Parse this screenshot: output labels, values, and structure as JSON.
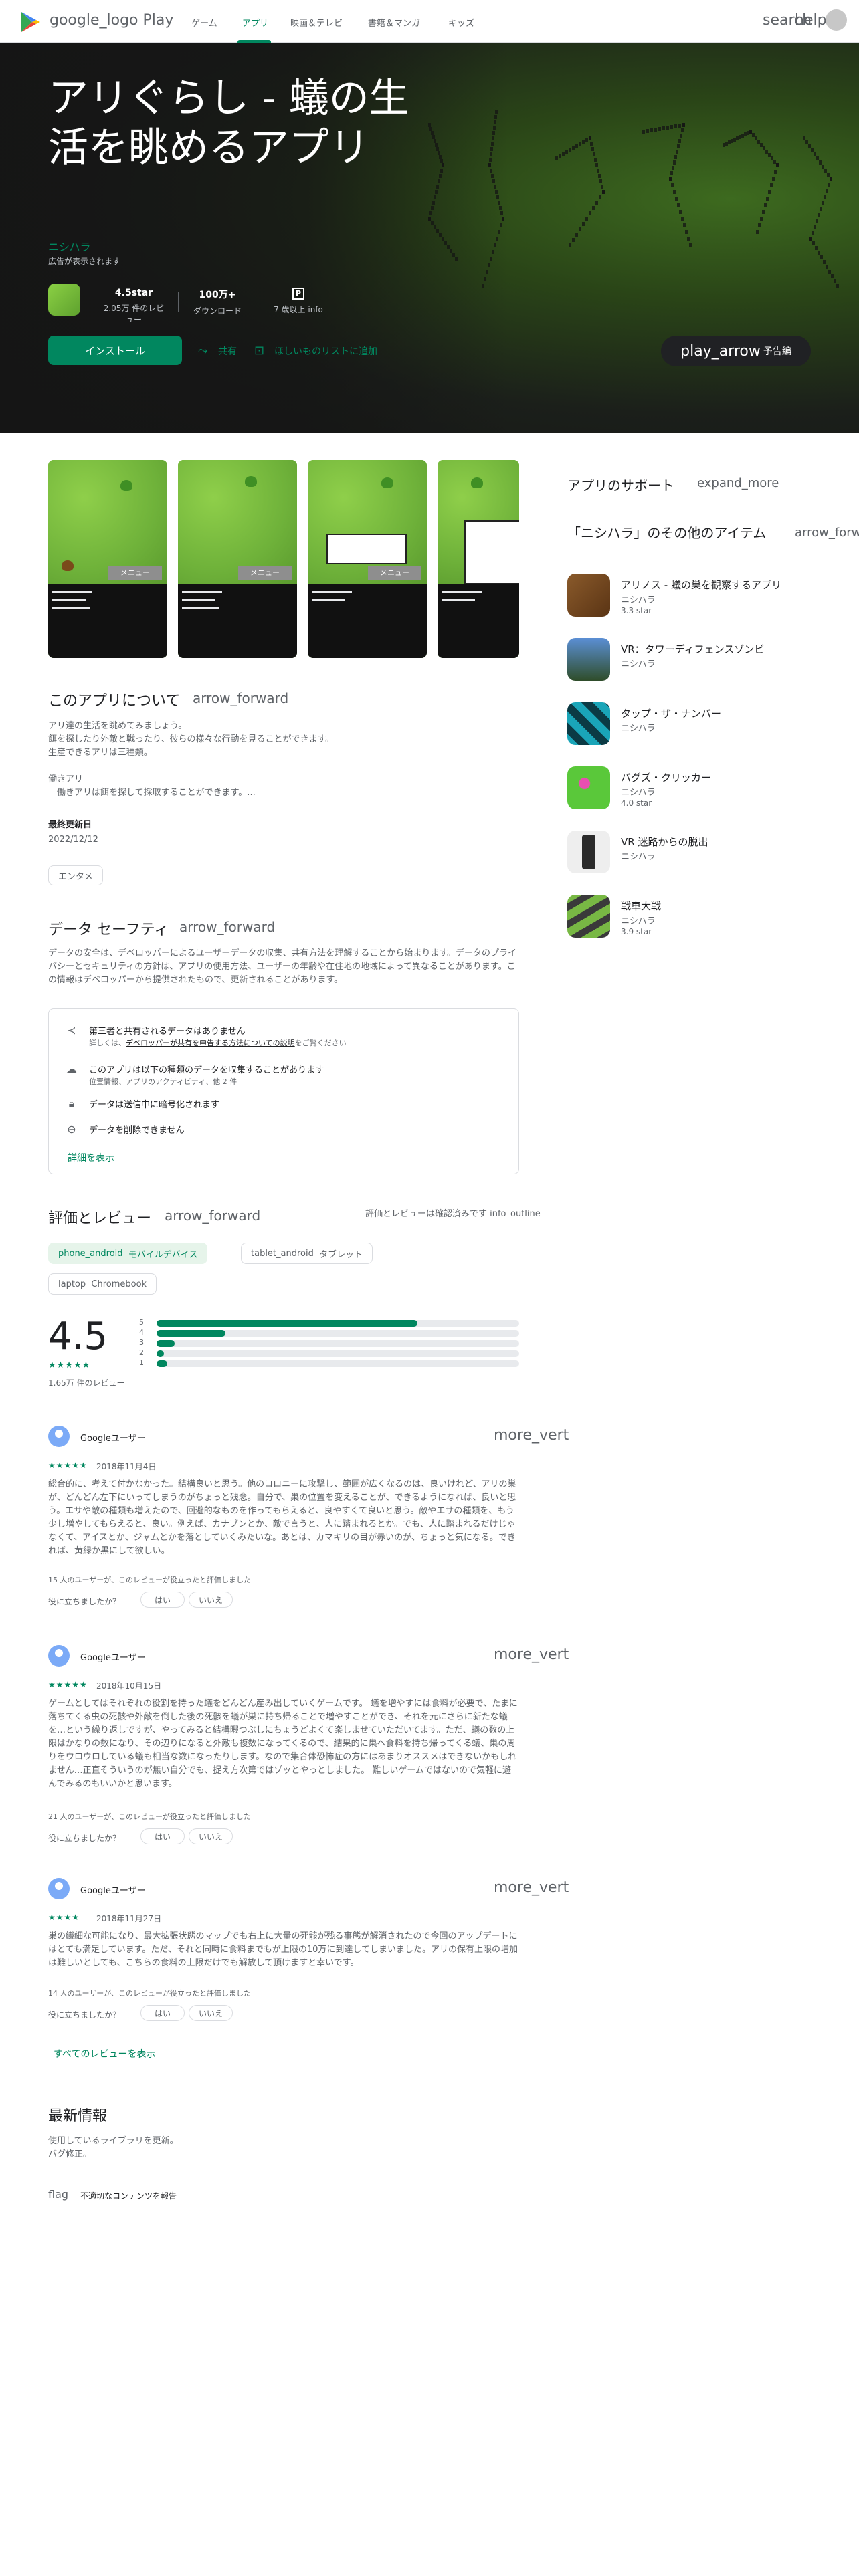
{
  "nav": {
    "logo_label": "google_logo Play",
    "items": [
      "ゲーム",
      "アプリ",
      "映画＆テレビ",
      "書籍＆マンガ",
      "キッズ"
    ],
    "search_label": "search",
    "help_label": "help",
    "account_label": "account_circle"
  },
  "hero": {
    "title": "アリぐらし - 蟻の生活を眺めるアプリ",
    "developer": "ニシハラ",
    "ads_note": "広告が表示されます",
    "rating_value": "4.5star",
    "rating_label": "2.05万 件のレビュー",
    "downloads_value": "100万+",
    "downloads_label": "ダウンロード",
    "content_rating_badge": "P",
    "content_rating_label": "7 歳以上 info",
    "install_label": "インストール",
    "share_label": "共有",
    "wishlist_label": "ほしいものリストに追加",
    "trailer_label": "play_arrow",
    "trailer_sub": "予告編"
  },
  "screenshots": [
    {
      "menu_label": "メニュー"
    },
    {
      "menu_label": "メニュー"
    },
    {
      "menu_label": "メニュー"
    },
    {
      "menu_label": ""
    }
  ],
  "about": {
    "title": "このアプリについて",
    "arrow": "arrow_forward",
    "lines": [
      "アリ達の生活を眺めてみましょう。",
      "餌を探したり外敵と戦ったり、彼らの様々な行動を見ることができます。",
      "生産できるアリは三種類。",
      "",
      "働きアリ",
      "　働きアリは餌を探して採取することができます。..."
    ],
    "updated_label": "最終更新日",
    "updated_value": "2022/12/12",
    "category_chip": "エンタメ"
  },
  "data_safety": {
    "title": "データ セーフティ",
    "arrow": "arrow_forward",
    "description": "データの安全は、デベロッパーによるユーザーデータの収集、共有方法を理解することから始まります。データのプライバシーとセキュリティの方針は、アプリの使用方法、ユーザーの年齢や在住地の地域によって異なることがあります。この情報はデベロッパーから提供されたもので、更新されることがあります。",
    "rows": [
      {
        "icon": "share-icon",
        "text": "第三者と共有されるデータはありません",
        "sub_pre": "詳しくは、",
        "sub_link": "デベロッパーが共有を申告する方法についての説明",
        "sub_post": "をご覧ください"
      },
      {
        "icon": "cloud-upload-icon",
        "text": "このアプリは以下の種類のデータを収集することがあります",
        "sub_pre": "位置情報、アプリのアクティビティ、他 2 件",
        "sub_link": "",
        "sub_post": ""
      },
      {
        "icon": "lock-icon",
        "text": "データは送信中に暗号化されます",
        "sub_pre": "",
        "sub_link": "",
        "sub_post": ""
      },
      {
        "icon": "delete-icon",
        "text": "データを削除できません",
        "sub_pre": "",
        "sub_link": "",
        "sub_post": ""
      }
    ],
    "more_label": "詳細を表示"
  },
  "ratings": {
    "title": "評価とレビュー",
    "arrow": "arrow_forward",
    "verified_note": "評価とレビューは確認済みです info_outline",
    "device_chips": [
      {
        "icon": "phone_android",
        "label": "モバイルデバイス",
        "selected": true
      },
      {
        "icon": "tablet_android",
        "label": "タブレット",
        "selected": false
      },
      {
        "icon": "laptop",
        "label": "Chromebook",
        "selected": false
      }
    ],
    "score": "4.5",
    "stars": "★★★★★",
    "count": "1.65万 件のレビュー",
    "distribution": [
      {
        "star": "5",
        "fraction": 0.72
      },
      {
        "star": "4",
        "fraction": 0.19
      },
      {
        "star": "3",
        "fraction": 0.05
      },
      {
        "star": "2",
        "fraction": 0.02
      },
      {
        "star": "1",
        "fraction": 0.03
      }
    ]
  },
  "reviews": [
    {
      "name": "Googleユーザー",
      "menu": "more_vert",
      "stars": "★★★★★",
      "date": "2018年11月4日",
      "body": "総合的に、考えて付かなかった。結構良いと思う。他のコロニーに攻撃し、範囲が広くなるのは、良いけれど、アリの巣が、どんどん左下にいってしまうのがちょっと残念。自分で、巣の位置を変えることが、できるようになれば、良いと思う。エサや敵の種類も増えたので、回避的なものを作ってもらえると、良やすくて良いと思う。敵やエサの種類を、もう少し増やしてもらえると、良い。例えば、カナブンとか、敵で言うと、人に踏まれるとか。でも、人に踏まれるだけじゃなくて、アイスとか、ジャムとかを落としていくみたいな。あとは、カマキリの目が赤いのが、ちょっと気になる。できれば、黄緑か黒にして欲しい。",
      "helpful": "15 人のユーザーが、このレビューが役立ったと評価しました",
      "question": "役に立ちましたか？",
      "yes": "はい",
      "no": "いいえ"
    },
    {
      "name": "Googleユーザー",
      "menu": "more_vert",
      "stars": "★★★★★",
      "date": "2018年10月15日",
      "body": "ゲームとしてはそれぞれの役割を持った蟻をどんどん産み出していくゲームです。 蟻を増やすには食料が必要で、たまに落ちてくる虫の死骸や外敵を倒した後の死骸を蟻が巣に持ち帰ることで増やすことができ、それを元にさらに新たな蟻を…という繰り返しですが、やってみると結構暇つぶしにちょうどよくて楽しませていただいてます。ただ、蟻の数の上限はかなりの数になり、その辺りになると外敵も複数になってくるので、結果的に巣へ食料を持ち帰ってくる蟻、巣の周りをウロウロしている蟻も相当な数になったりします。なので集合体恐怖症の方にはあまりオススメはできないかもしれません…正直そういうのが無い自分でも、捉え方次第ではゾッとやっとしました。 難しいゲームではないので気軽に遊んでみるのもいいかと思います。",
      "helpful": "21 人のユーザーが、このレビューが役立ったと評価しました",
      "question": "役に立ちましたか？",
      "yes": "はい",
      "no": "いいえ"
    },
    {
      "name": "Googleユーザー",
      "menu": "more_vert",
      "stars": "★★★★",
      "date": "2018年11月27日",
      "body": "巣の繊細な可能になり、最大拡張状態のマップでも右上に大量の死骸が残る事態が解消されたので今回のアップデートにはとても満足しています。ただ、それと同時に食料までもが上限の10万に到達してしまいました。アリの保有上限の増加は難しいとしても、こちらの食料の上限だけでも解放して頂けますと幸いです。",
      "helpful": "14 人のユーザーが、このレビューが役立ったと評価しました",
      "question": "役に立ちましたか？",
      "yes": "はい",
      "no": "いいえ"
    }
  ],
  "all_reviews_label": "すべてのレビューを表示",
  "whats_new": {
    "title": "最新情報",
    "lines": [
      "使用しているライブラリを更新。",
      "バグ修正。"
    ]
  },
  "report": {
    "icon": "flag",
    "label": "不適切なコンテンツを報告"
  },
  "sidebar": {
    "support_title": "アプリのサポート",
    "support_arrow": "expand_more",
    "more_title": "「ニシハラ」のその他のアイテム",
    "more_arrow": "arrow_forward",
    "apps": [
      {
        "name": "アリノス - 蟻の巣を観察するアプリ",
        "dev": "ニシハラ",
        "rating": "3.3 star"
      },
      {
        "name": "VR：タワーディフェンスゾンビ",
        "dev": "ニシハラ",
        "rating": ""
      },
      {
        "name": "タップ・ザ・ナンバー",
        "dev": "ニシハラ",
        "rating": ""
      },
      {
        "name": "バグズ・クリッカー",
        "dev": "ニシハラ",
        "rating": "4.0 star"
      },
      {
        "name": "VR 迷路からの脱出",
        "dev": "ニシハラ",
        "rating": ""
      },
      {
        "name": "戦車大戦",
        "dev": "ニシハラ",
        "rating": "3.9 star"
      }
    ]
  },
  "colors": {
    "accent": "#01875f",
    "hero_bg": "#1b1f1a",
    "text": "#202124",
    "muted": "#5f6368"
  }
}
